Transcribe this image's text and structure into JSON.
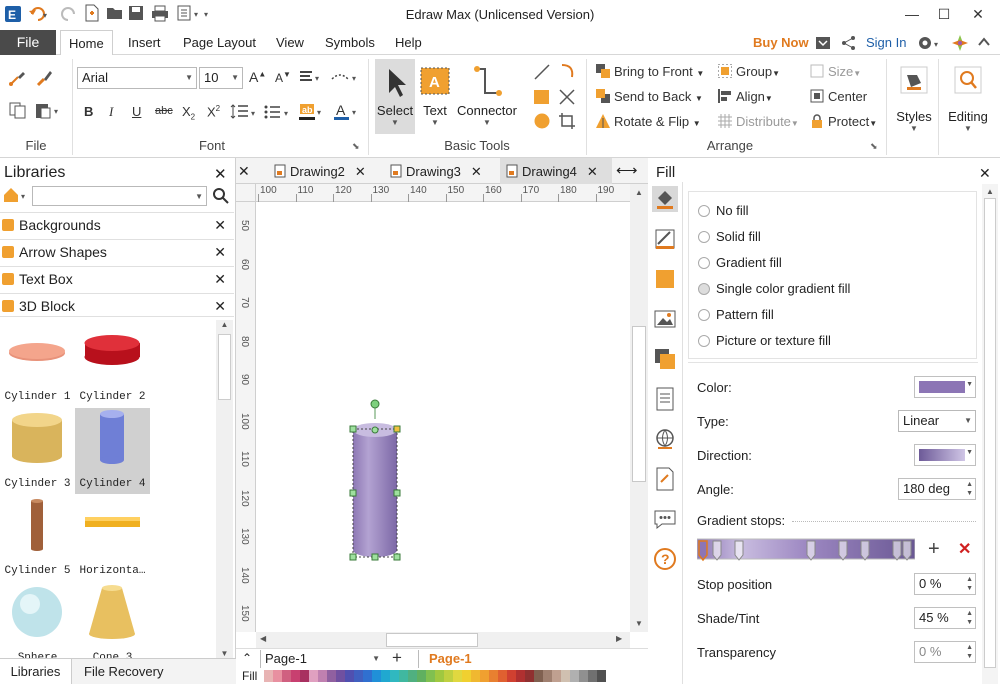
{
  "window": {
    "title": "Edraw Max (Unlicensed Version)"
  },
  "menu": {
    "file": "File",
    "tabs": [
      "Home",
      "Insert",
      "Page Layout",
      "View",
      "Symbols",
      "Help"
    ],
    "buy_now": "Buy Now",
    "sign_in": "Sign In"
  },
  "ribbon": {
    "font": {
      "family": "Arial",
      "size": "10",
      "group_label": "Font"
    },
    "file_group_label": "File",
    "basic_tools": {
      "select": "Select",
      "text": "Text",
      "connector": "Connector",
      "group_label": "Basic Tools"
    },
    "arrange": {
      "bring_to_front": "Bring to Front",
      "send_to_back": "Send to Back",
      "rotate_flip": "Rotate & Flip",
      "group": "Group",
      "align": "Align",
      "distribute": "Distribute",
      "size": "Size",
      "center": "Center",
      "protect": "Protect",
      "group_label": "Arrange"
    },
    "styles": "Styles",
    "editing": "Editing"
  },
  "libraries": {
    "title": "Libraries",
    "categories": [
      "Backgrounds",
      "Arrow Shapes",
      "Text Box",
      "3D Block"
    ],
    "shapes": [
      "Cylinder 1",
      "Cylinder 2",
      "Cylinder 3",
      "Cylinder 4",
      "Cylinder 5",
      "Horizonta…",
      "Sphere",
      "Cone 3"
    ],
    "bottom_tabs": [
      "Libraries",
      "File Recovery"
    ]
  },
  "documents": {
    "tabs": [
      "Drawing2",
      "Drawing3",
      "Drawing4"
    ],
    "h_ruler": [
      "100",
      "110",
      "120",
      "130",
      "140",
      "150",
      "160",
      "170",
      "180",
      "190"
    ],
    "v_ruler": [
      "50",
      "60",
      "70",
      "80",
      "90",
      "100",
      "110",
      "120",
      "130",
      "140",
      "150"
    ],
    "page_select": "Page-1",
    "page_tab": "Page-1",
    "fill_label": "Fill"
  },
  "fill_panel": {
    "title": "Fill",
    "options": [
      "No fill",
      "Solid fill",
      "Gradient fill",
      "Single color gradient fill",
      "Pattern fill",
      "Picture or texture fill"
    ],
    "selected_option": "Single color gradient fill",
    "color_label": "Color:",
    "type_label": "Type:",
    "type_value": "Linear",
    "direction_label": "Direction:",
    "angle_label": "Angle:",
    "angle_value": "180 deg",
    "gradient_stops_label": "Gradient stops:",
    "stop_position_label": "Stop position",
    "stop_position_value": "0 %",
    "shade_tint_label": "Shade/Tint",
    "shade_tint_value": "45 %",
    "transparency_label": "Transparency",
    "transparency_value": "0 %"
  },
  "colors": {
    "accent_orange": "#e07a1f",
    "file_tab_bg": "#4a4a4a",
    "shape_fill": "#9a86bf",
    "icon_orange": "#f0a030"
  }
}
